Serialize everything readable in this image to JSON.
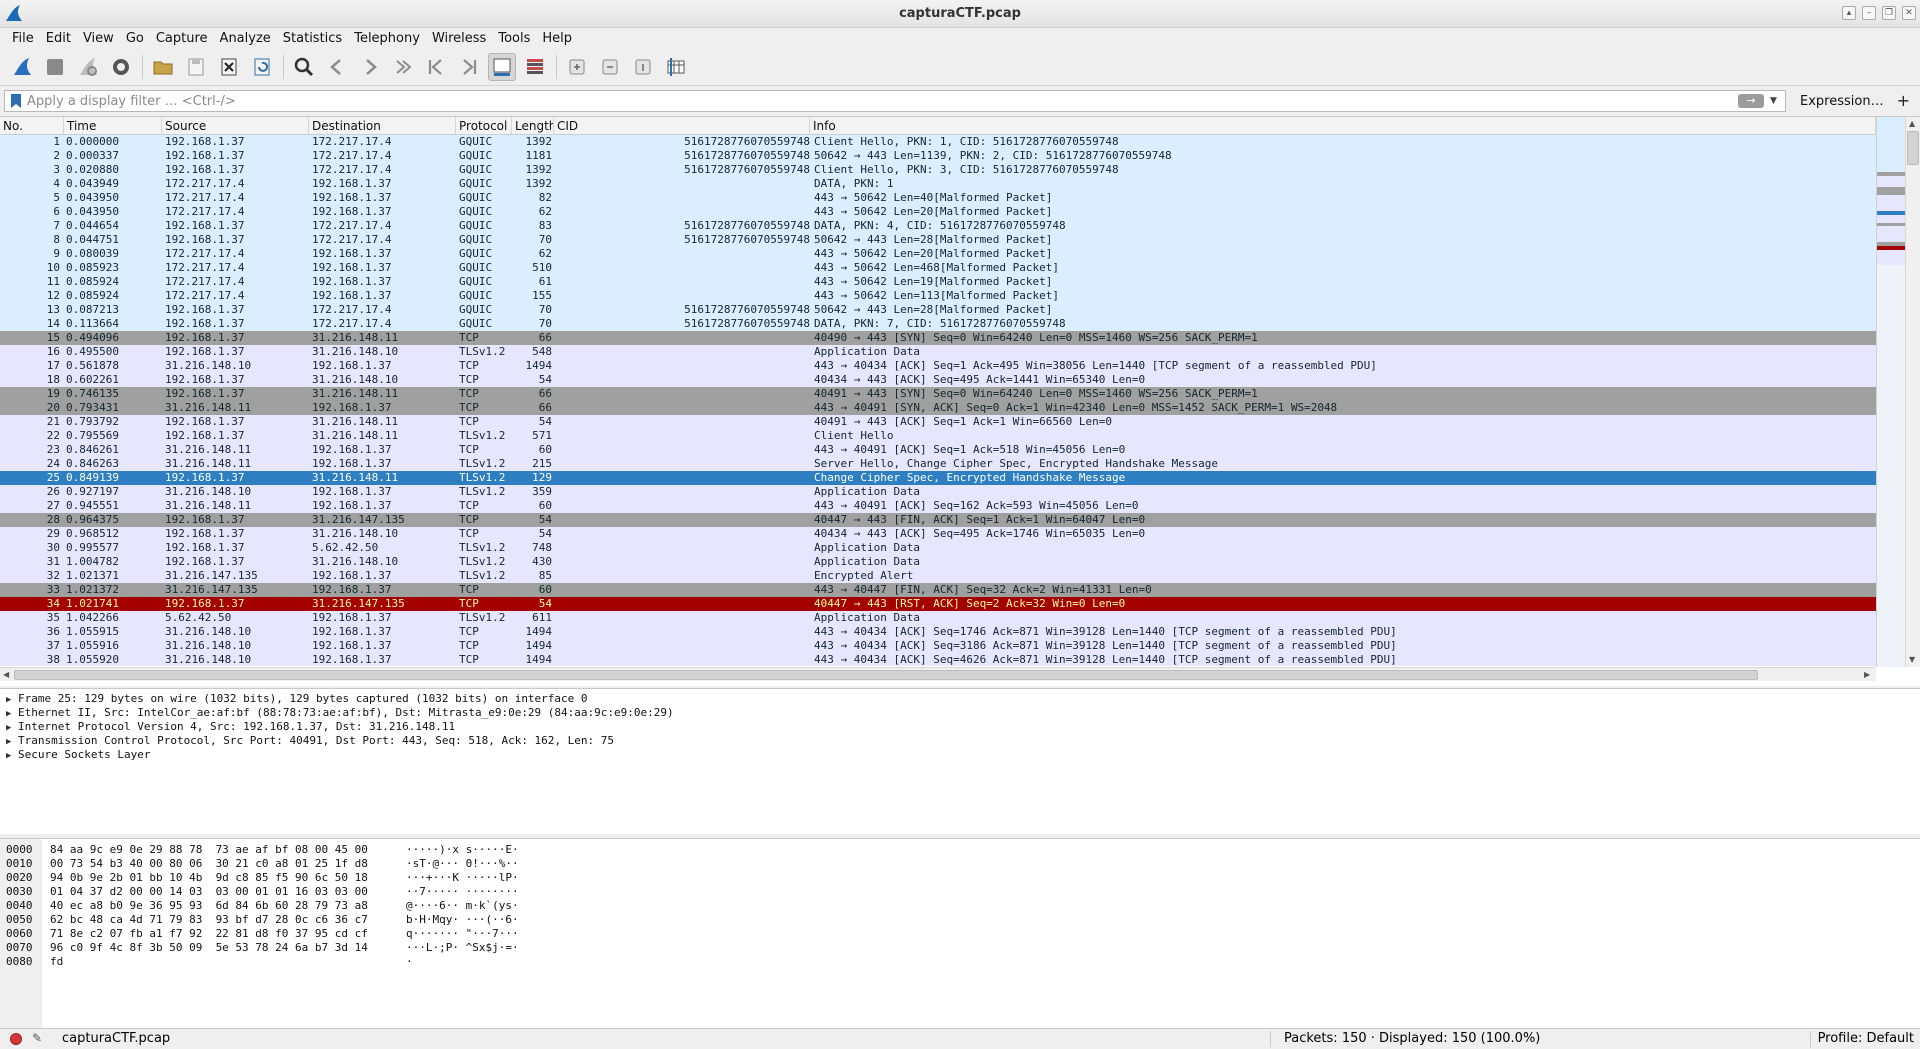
{
  "window": {
    "title": "capturaCTF.pcap",
    "controls": [
      "▴",
      "–",
      "❐",
      "✕"
    ]
  },
  "menu": [
    "File",
    "Edit",
    "View",
    "Go",
    "Capture",
    "Analyze",
    "Statistics",
    "Telephony",
    "Wireless",
    "Tools",
    "Help"
  ],
  "toolbar": {
    "buttons": [
      "start-capture-icon",
      "stop-capture-icon",
      "restart-capture-icon",
      "capture-options-icon",
      "open-file-icon",
      "save-file-icon",
      "close-file-icon",
      "reload-file-icon",
      "find-packet-icon",
      "go-back-icon",
      "go-forward-icon",
      "go-to-packet-icon",
      "first-packet-icon",
      "last-packet-icon",
      "autoscroll-icon",
      "colorize-icon",
      "zoom-in-icon",
      "zoom-out-icon",
      "normal-size-icon",
      "resize-columns-icon"
    ]
  },
  "filter": {
    "placeholder": "Apply a display filter … <Ctrl-/>",
    "expression_label": "Expression…",
    "plus": "+"
  },
  "columns": [
    "No.",
    "Time",
    "Source",
    "Destination",
    "Protocol",
    "Length",
    "CID",
    "Info"
  ],
  "packets": [
    {
      "no": "1",
      "time": "0.000000",
      "src": "192.168.1.37",
      "dst": "172.217.17.4",
      "proto": "GQUIC",
      "len": "1392",
      "cid": "5161728776070559748",
      "info": "Client Hello, PKN: 1, CID: 5161728776070559748",
      "style": "gquic"
    },
    {
      "no": "2",
      "time": "0.000337",
      "src": "192.168.1.37",
      "dst": "172.217.17.4",
      "proto": "GQUIC",
      "len": "1181",
      "cid": "5161728776070559748",
      "info": "50642 → 443 Len=1139, PKN: 2, CID: 5161728776070559748",
      "style": "gquic"
    },
    {
      "no": "3",
      "time": "0.020880",
      "src": "192.168.1.37",
      "dst": "172.217.17.4",
      "proto": "GQUIC",
      "len": "1392",
      "cid": "5161728776070559748",
      "info": "Client Hello, PKN: 3, CID: 5161728776070559748",
      "style": "gquic"
    },
    {
      "no": "4",
      "time": "0.043949",
      "src": "172.217.17.4",
      "dst": "192.168.1.37",
      "proto": "GQUIC",
      "len": "1392",
      "cid": "",
      "info": "DATA, PKN: 1",
      "style": "gquic"
    },
    {
      "no": "5",
      "time": "0.043950",
      "src": "172.217.17.4",
      "dst": "192.168.1.37",
      "proto": "GQUIC",
      "len": "82",
      "cid": "",
      "info": "443 → 50642 Len=40[Malformed Packet]",
      "style": "gquic"
    },
    {
      "no": "6",
      "time": "0.043950",
      "src": "172.217.17.4",
      "dst": "192.168.1.37",
      "proto": "GQUIC",
      "len": "62",
      "cid": "",
      "info": "443 → 50642 Len=20[Malformed Packet]",
      "style": "gquic"
    },
    {
      "no": "7",
      "time": "0.044654",
      "src": "192.168.1.37",
      "dst": "172.217.17.4",
      "proto": "GQUIC",
      "len": "83",
      "cid": "5161728776070559748",
      "info": "DATA, PKN: 4, CID: 5161728776070559748",
      "style": "gquic"
    },
    {
      "no": "8",
      "time": "0.044751",
      "src": "192.168.1.37",
      "dst": "172.217.17.4",
      "proto": "GQUIC",
      "len": "70",
      "cid": "5161728776070559748",
      "info": "50642 → 443 Len=28[Malformed Packet]",
      "style": "gquic"
    },
    {
      "no": "9",
      "time": "0.080039",
      "src": "172.217.17.4",
      "dst": "192.168.1.37",
      "proto": "GQUIC",
      "len": "62",
      "cid": "",
      "info": "443 → 50642 Len=20[Malformed Packet]",
      "style": "gquic"
    },
    {
      "no": "10",
      "time": "0.085923",
      "src": "172.217.17.4",
      "dst": "192.168.1.37",
      "proto": "GQUIC",
      "len": "510",
      "cid": "",
      "info": "443 → 50642 Len=468[Malformed Packet]",
      "style": "gquic"
    },
    {
      "no": "11",
      "time": "0.085924",
      "src": "172.217.17.4",
      "dst": "192.168.1.37",
      "proto": "GQUIC",
      "len": "61",
      "cid": "",
      "info": "443 → 50642 Len=19[Malformed Packet]",
      "style": "gquic"
    },
    {
      "no": "12",
      "time": "0.085924",
      "src": "172.217.17.4",
      "dst": "192.168.1.37",
      "proto": "GQUIC",
      "len": "155",
      "cid": "",
      "info": "443 → 50642 Len=113[Malformed Packet]",
      "style": "gquic"
    },
    {
      "no": "13",
      "time": "0.087213",
      "src": "192.168.1.37",
      "dst": "172.217.17.4",
      "proto": "GQUIC",
      "len": "70",
      "cid": "5161728776070559748",
      "info": "50642 → 443 Len=28[Malformed Packet]",
      "style": "gquic"
    },
    {
      "no": "14",
      "time": "0.113664",
      "src": "192.168.1.37",
      "dst": "172.217.17.4",
      "proto": "GQUIC",
      "len": "70",
      "cid": "5161728776070559748",
      "info": "DATA, PKN: 7, CID: 5161728776070559748",
      "style": "gquic"
    },
    {
      "no": "15",
      "time": "0.494096",
      "src": "192.168.1.37",
      "dst": "31.216.148.11",
      "proto": "TCP",
      "len": "66",
      "cid": "",
      "info": "40490 → 443 [SYN] Seq=0 Win=64240 Len=0 MSS=1460 WS=256 SACK_PERM=1",
      "style": "syn"
    },
    {
      "no": "16",
      "time": "0.495500",
      "src": "192.168.1.37",
      "dst": "31.216.148.10",
      "proto": "TLSv1.2",
      "len": "548",
      "cid": "",
      "info": "Application Data",
      "style": "tls"
    },
    {
      "no": "17",
      "time": "0.561878",
      "src": "31.216.148.10",
      "dst": "192.168.1.37",
      "proto": "TCP",
      "len": "1494",
      "cid": "",
      "info": "443 → 40434 [ACK] Seq=1 Ack=495 Win=38056 Len=1440 [TCP segment of a reassembled PDU]",
      "style": "tcp"
    },
    {
      "no": "18",
      "time": "0.602261",
      "src": "192.168.1.37",
      "dst": "31.216.148.10",
      "proto": "TCP",
      "len": "54",
      "cid": "",
      "info": "40434 → 443 [ACK] Seq=495 Ack=1441 Win=65340 Len=0",
      "style": "tcp"
    },
    {
      "no": "19",
      "time": "0.746135",
      "src": "192.168.1.37",
      "dst": "31.216.148.11",
      "proto": "TCP",
      "len": "66",
      "cid": "",
      "info": "40491 → 443 [SYN] Seq=0 Win=64240 Len=0 MSS=1460 WS=256 SACK_PERM=1",
      "style": "syn"
    },
    {
      "no": "20",
      "time": "0.793431",
      "src": "31.216.148.11",
      "dst": "192.168.1.37",
      "proto": "TCP",
      "len": "66",
      "cid": "",
      "info": "443 → 40491 [SYN, ACK] Seq=0 Ack=1 Win=42340 Len=0 MSS=1452 SACK_PERM=1 WS=2048",
      "style": "syn"
    },
    {
      "no": "21",
      "time": "0.793792",
      "src": "192.168.1.37",
      "dst": "31.216.148.11",
      "proto": "TCP",
      "len": "54",
      "cid": "",
      "info": "40491 → 443 [ACK] Seq=1 Ack=1 Win=66560 Len=0",
      "style": "tcp"
    },
    {
      "no": "22",
      "time": "0.795569",
      "src": "192.168.1.37",
      "dst": "31.216.148.11",
      "proto": "TLSv1.2",
      "len": "571",
      "cid": "",
      "info": "Client Hello",
      "style": "tls"
    },
    {
      "no": "23",
      "time": "0.846261",
      "src": "31.216.148.11",
      "dst": "192.168.1.37",
      "proto": "TCP",
      "len": "60",
      "cid": "",
      "info": "443 → 40491 [ACK] Seq=1 Ack=518 Win=45056 Len=0",
      "style": "tcp"
    },
    {
      "no": "24",
      "time": "0.846263",
      "src": "31.216.148.11",
      "dst": "192.168.1.37",
      "proto": "TLSv1.2",
      "len": "215",
      "cid": "",
      "info": "Server Hello, Change Cipher Spec, Encrypted Handshake Message",
      "style": "tls"
    },
    {
      "no": "25",
      "time": "0.849139",
      "src": "192.168.1.37",
      "dst": "31.216.148.11",
      "proto": "TLSv1.2",
      "len": "129",
      "cid": "",
      "info": "Change Cipher Spec, Encrypted Handshake Message",
      "style": "selected"
    },
    {
      "no": "26",
      "time": "0.927197",
      "src": "31.216.148.10",
      "dst": "192.168.1.37",
      "proto": "TLSv1.2",
      "len": "359",
      "cid": "",
      "info": "Application Data",
      "style": "tls"
    },
    {
      "no": "27",
      "time": "0.945551",
      "src": "31.216.148.11",
      "dst": "192.168.1.37",
      "proto": "TCP",
      "len": "60",
      "cid": "",
      "info": "443 → 40491 [ACK] Seq=162 Ack=593 Win=45056 Len=0",
      "style": "tcp"
    },
    {
      "no": "28",
      "time": "0.964375",
      "src": "192.168.1.37",
      "dst": "31.216.147.135",
      "proto": "TCP",
      "len": "54",
      "cid": "",
      "info": "40447 → 443 [FIN, ACK] Seq=1 Ack=1 Win=64047 Len=0",
      "style": "syn"
    },
    {
      "no": "29",
      "time": "0.968512",
      "src": "192.168.1.37",
      "dst": "31.216.148.10",
      "proto": "TCP",
      "len": "54",
      "cid": "",
      "info": "40434 → 443 [ACK] Seq=495 Ack=1746 Win=65035 Len=0",
      "style": "tcp"
    },
    {
      "no": "30",
      "time": "0.995577",
      "src": "192.168.1.37",
      "dst": "5.62.42.50",
      "proto": "TLSv1.2",
      "len": "748",
      "cid": "",
      "info": "Application Data",
      "style": "tls"
    },
    {
      "no": "31",
      "time": "1.004782",
      "src": "192.168.1.37",
      "dst": "31.216.148.10",
      "proto": "TLSv1.2",
      "len": "430",
      "cid": "",
      "info": "Application Data",
      "style": "tls"
    },
    {
      "no": "32",
      "time": "1.021371",
      "src": "31.216.147.135",
      "dst": "192.168.1.37",
      "proto": "TLSv1.2",
      "len": "85",
      "cid": "",
      "info": "Encrypted Alert",
      "style": "tls"
    },
    {
      "no": "33",
      "time": "1.021372",
      "src": "31.216.147.135",
      "dst": "192.168.1.37",
      "proto": "TCP",
      "len": "60",
      "cid": "",
      "info": "443 → 40447 [FIN, ACK] Seq=32 Ack=2 Win=41331 Len=0",
      "style": "syn"
    },
    {
      "no": "34",
      "time": "1.021741",
      "src": "192.168.1.37",
      "dst": "31.216.147.135",
      "proto": "TCP",
      "len": "54",
      "cid": "",
      "info": "40447 → 443 [RST, ACK] Seq=2 Ack=32 Win=0 Len=0",
      "style": "rst"
    },
    {
      "no": "35",
      "time": "1.042266",
      "src": "5.62.42.50",
      "dst": "192.168.1.37",
      "proto": "TLSv1.2",
      "len": "611",
      "cid": "",
      "info": "Application Data",
      "style": "tls"
    },
    {
      "no": "36",
      "time": "1.055915",
      "src": "31.216.148.10",
      "dst": "192.168.1.37",
      "proto": "TCP",
      "len": "1494",
      "cid": "",
      "info": "443 → 40434 [ACK] Seq=1746 Ack=871 Win=39128 Len=1440 [TCP segment of a reassembled PDU]",
      "style": "tcp"
    },
    {
      "no": "37",
      "time": "1.055916",
      "src": "31.216.148.10",
      "dst": "192.168.1.37",
      "proto": "TCP",
      "len": "1494",
      "cid": "",
      "info": "443 → 40434 [ACK] Seq=3186 Ack=871 Win=39128 Len=1440 [TCP segment of a reassembled PDU]",
      "style": "tcp"
    },
    {
      "no": "38",
      "time": "1.055920",
      "src": "31.216.148.10",
      "dst": "192.168.1.37",
      "proto": "TCP",
      "len": "1494",
      "cid": "",
      "info": "443 → 40434 [ACK] Seq=4626 Ack=871 Win=39128 Len=1440 [TCP segment of a reassembled PDU]",
      "style": "tcp"
    }
  ],
  "details": [
    "Frame 25: 129 bytes on wire (1032 bits), 129 bytes captured (1032 bits) on interface 0",
    "Ethernet II, Src: IntelCor_ae:af:bf (88:78:73:ae:af:bf), Dst: Mitrasta_e9:0e:29 (84:aa:9c:e9:0e:29)",
    "Internet Protocol Version 4, Src: 192.168.1.37, Dst: 31.216.148.11",
    "Transmission Control Protocol, Src Port: 40491, Dst Port: 443, Seq: 518, Ack: 162, Len: 75",
    "Secure Sockets Layer"
  ],
  "bytes": [
    {
      "off": "0000",
      "hex": "84 aa 9c e9 0e 29 88 78  73 ae af bf 08 00 45 00",
      "ascii": "·····)·x s·····E·"
    },
    {
      "off": "0010",
      "hex": "00 73 54 b3 40 00 80 06  30 21 c0 a8 01 25 1f d8",
      "ascii": "·sT·@··· 0!···%··"
    },
    {
      "off": "0020",
      "hex": "94 0b 9e 2b 01 bb 10 4b  9d c8 85 f5 90 6c 50 18",
      "ascii": "···+···K ·····lP·"
    },
    {
      "off": "0030",
      "hex": "01 04 37 d2 00 00 14 03  03 00 01 01 16 03 03 00",
      "ascii": "··7····· ········"
    },
    {
      "off": "0040",
      "hex": "40 ec a8 b0 9e 36 95 93  6d 84 6b 60 28 79 73 a8",
      "ascii": "@····6·· m·k`(ys·"
    },
    {
      "off": "0050",
      "hex": "62 bc 48 ca 4d 71 79 83  93 bf d7 28 0c c6 36 c7",
      "ascii": "b·H·Mqy· ···(··6·"
    },
    {
      "off": "0060",
      "hex": "71 8e c2 07 fb a1 f7 92  22 81 d8 f0 37 95 cd cf",
      "ascii": "q······· \"···7···"
    },
    {
      "off": "0070",
      "hex": "96 c0 9f 4c 8f 3b 50 09  5e 53 78 24 6a b7 3d 14",
      "ascii": "···L·;P· ^Sx$j·=·"
    },
    {
      "off": "0080",
      "hex": "fd",
      "ascii": "·"
    }
  ],
  "status": {
    "file": "capturaCTF.pcap",
    "packets": "Packets: 150 · Displayed: 150 (100.0%)",
    "profile": "Profile: Default"
  },
  "colors": {
    "gquic": "#daeeff",
    "tcp": "#e7e6ff",
    "syn": "#a0a0a0",
    "rst": "#a40000",
    "selected": "#2d7fc1"
  }
}
